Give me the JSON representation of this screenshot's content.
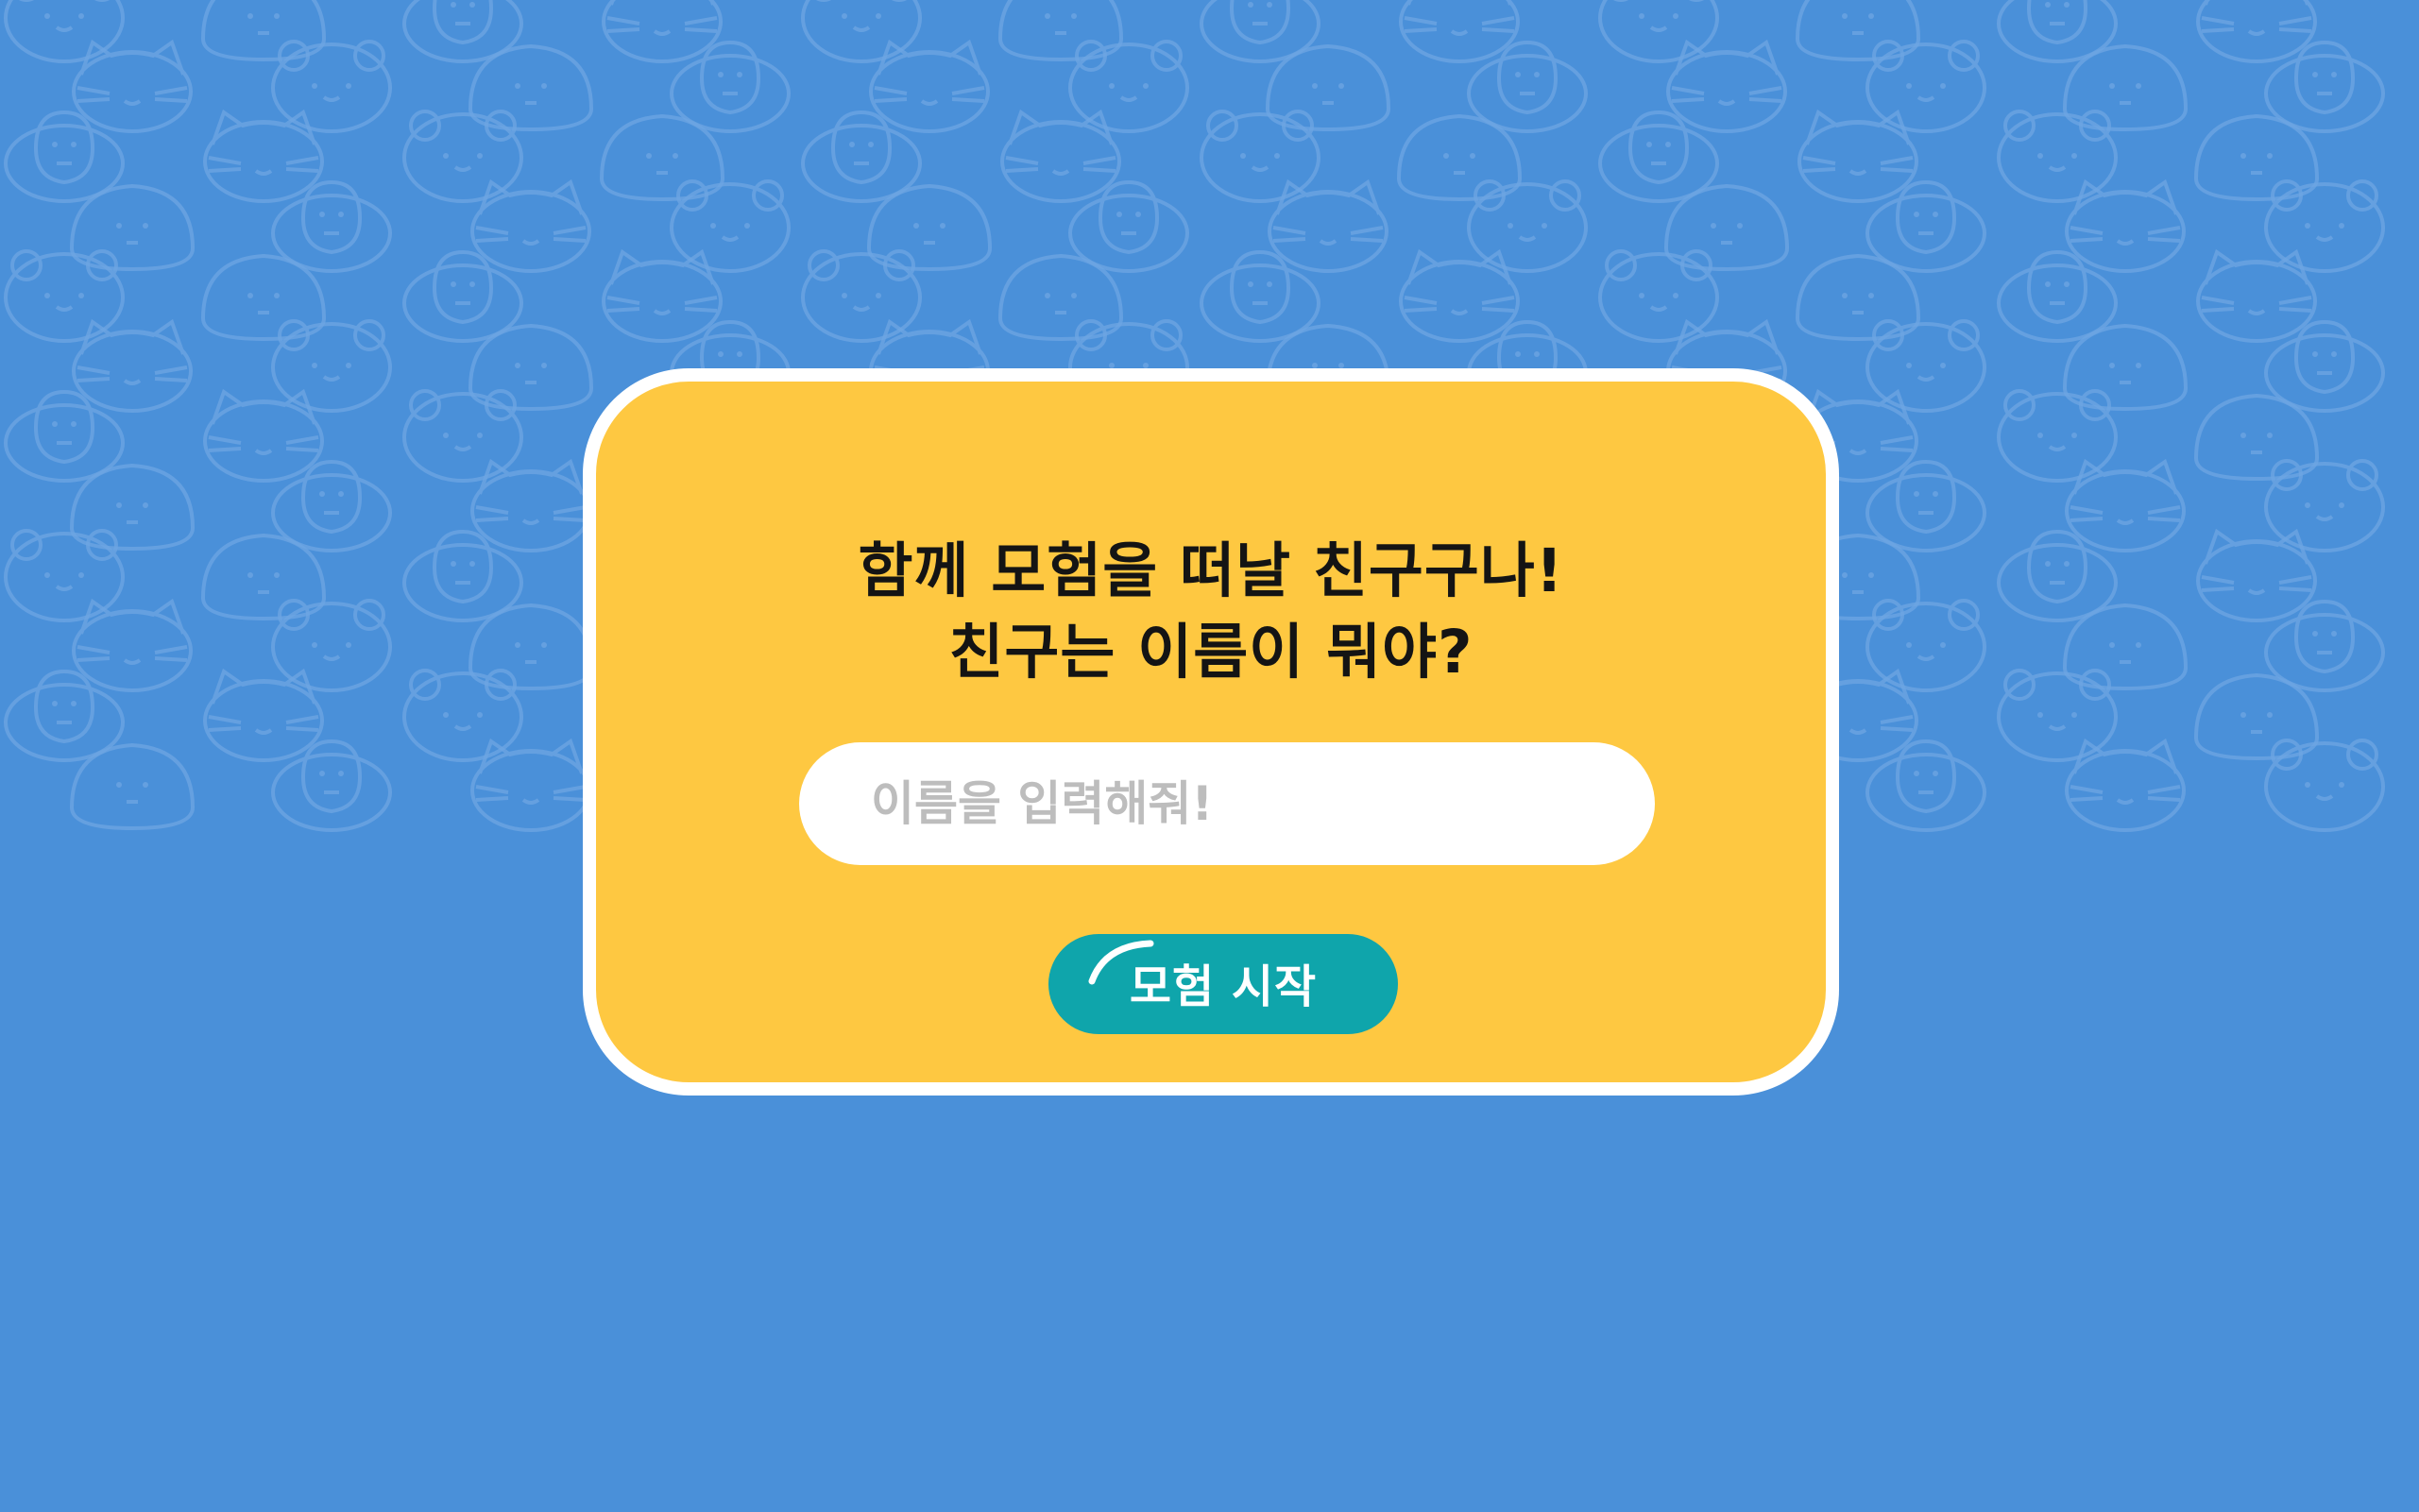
{
  "background": {
    "color": "#4a90d9",
    "pattern_color": "#6ea6e3",
    "pattern_icons": [
      "bear-face-icon",
      "round-face-icon",
      "monkey-face-icon",
      "cat-face-icon"
    ]
  },
  "dialog": {
    "background": "#fec841",
    "border_color": "#ffffff",
    "title_line1": "함께 모험을 떠날 친구구나!",
    "title_line2": "친구는 이름이 뭐야?",
    "name_input": {
      "placeholder": "이름을 입력해줘!",
      "value": ""
    },
    "start_button": {
      "label": "모험 시작",
      "color": "#0fa5ab"
    }
  }
}
